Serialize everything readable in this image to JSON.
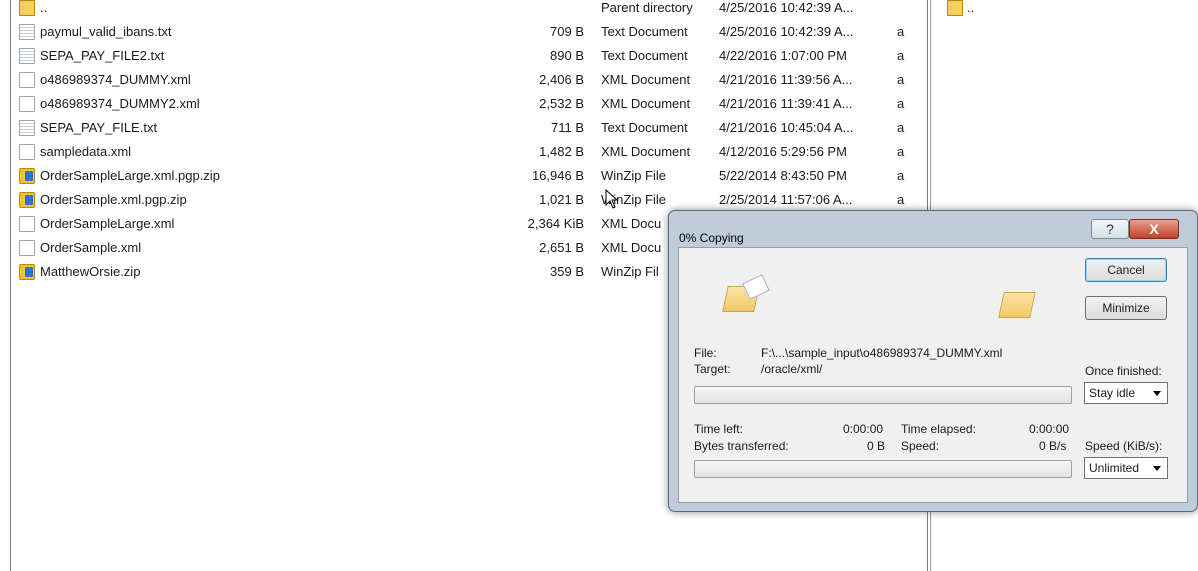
{
  "files": [
    {
      "name": "..",
      "size": "",
      "type": "Parent directory",
      "date": "4/25/2016 10:42:39 A...",
      "attr": "",
      "icon": "folder-up-icon"
    },
    {
      "name": "paymul_valid_ibans.txt",
      "size": "709 B",
      "type": "Text Document",
      "date": "4/25/2016 10:42:39 A...",
      "attr": "a",
      "icon": "text-file-icon"
    },
    {
      "name": "SEPA_PAY_FILE2.txt",
      "size": "890 B",
      "type": "Text Document",
      "date": "4/22/2016 1:07:00 PM",
      "attr": "a",
      "icon": "text-file-icon"
    },
    {
      "name": "o486989374_DUMMY.xml",
      "size": "2,406 B",
      "type": "XML Document",
      "date": "4/21/2016 11:39:56 A...",
      "attr": "a",
      "icon": "file-icon"
    },
    {
      "name": "o486989374_DUMMY2.xml",
      "size": "2,532 B",
      "type": "XML Document",
      "date": "4/21/2016 11:39:41 A...",
      "attr": "a",
      "icon": "file-icon"
    },
    {
      "name": "SEPA_PAY_FILE.txt",
      "size": "711 B",
      "type": "Text Document",
      "date": "4/21/2016 10:45:04 A...",
      "attr": "a",
      "icon": "text-file-icon"
    },
    {
      "name": "sampledata.xml",
      "size": "1,482 B",
      "type": "XML Document",
      "date": "4/12/2016 5:29:56 PM",
      "attr": "a",
      "icon": "file-icon"
    },
    {
      "name": "OrderSampleLarge.xml.pgp.zip",
      "size": "16,946 B",
      "type": "WinZip File",
      "date": "5/22/2014 8:43:50 PM",
      "attr": "a",
      "icon": "zip-file-icon"
    },
    {
      "name": "OrderSample.xml.pgp.zip",
      "size": "1,021 B",
      "type": "WinZip File",
      "date": "2/25/2014 11:57:06 A...",
      "attr": "a",
      "icon": "zip-file-icon"
    },
    {
      "name": "OrderSampleLarge.xml",
      "size": "2,364 KiB",
      "type": "XML Docu",
      "date": "",
      "attr": "",
      "icon": "file-icon"
    },
    {
      "name": "OrderSample.xml",
      "size": "2,651 B",
      "type": "XML Docu",
      "date": "",
      "attr": "",
      "icon": "file-icon"
    },
    {
      "name": "MatthewOrsie.zip",
      "size": "359 B",
      "type": "WinZip Fil",
      "date": "",
      "attr": "",
      "icon": "zip-file-icon"
    }
  ],
  "right_panel": {
    "parent": ".."
  },
  "dialog": {
    "title": "0% Copying",
    "help_label": "?",
    "close_label": "X",
    "cancel_label": "Cancel",
    "minimize_label": "Minimize",
    "file_label": "File:",
    "file_value": "F:\\...\\sample_input\\o486989374_DUMMY.xml",
    "target_label": "Target:",
    "target_value": "/oracle/xml/",
    "once_finished_label": "Once finished:",
    "once_finished_value": "Stay idle",
    "time_left_label": "Time left:",
    "time_left_value": "0:00:00",
    "time_elapsed_label": "Time elapsed:",
    "time_elapsed_value": "0:00:00",
    "bytes_label": "Bytes transferred:",
    "bytes_value": "0 B",
    "speed_label": "Speed:",
    "speed_value": "0 B/s",
    "speed_limit_label": "Speed (KiB/s):",
    "speed_limit_value": "Unlimited",
    "file_progress": 0,
    "total_progress": 0
  }
}
